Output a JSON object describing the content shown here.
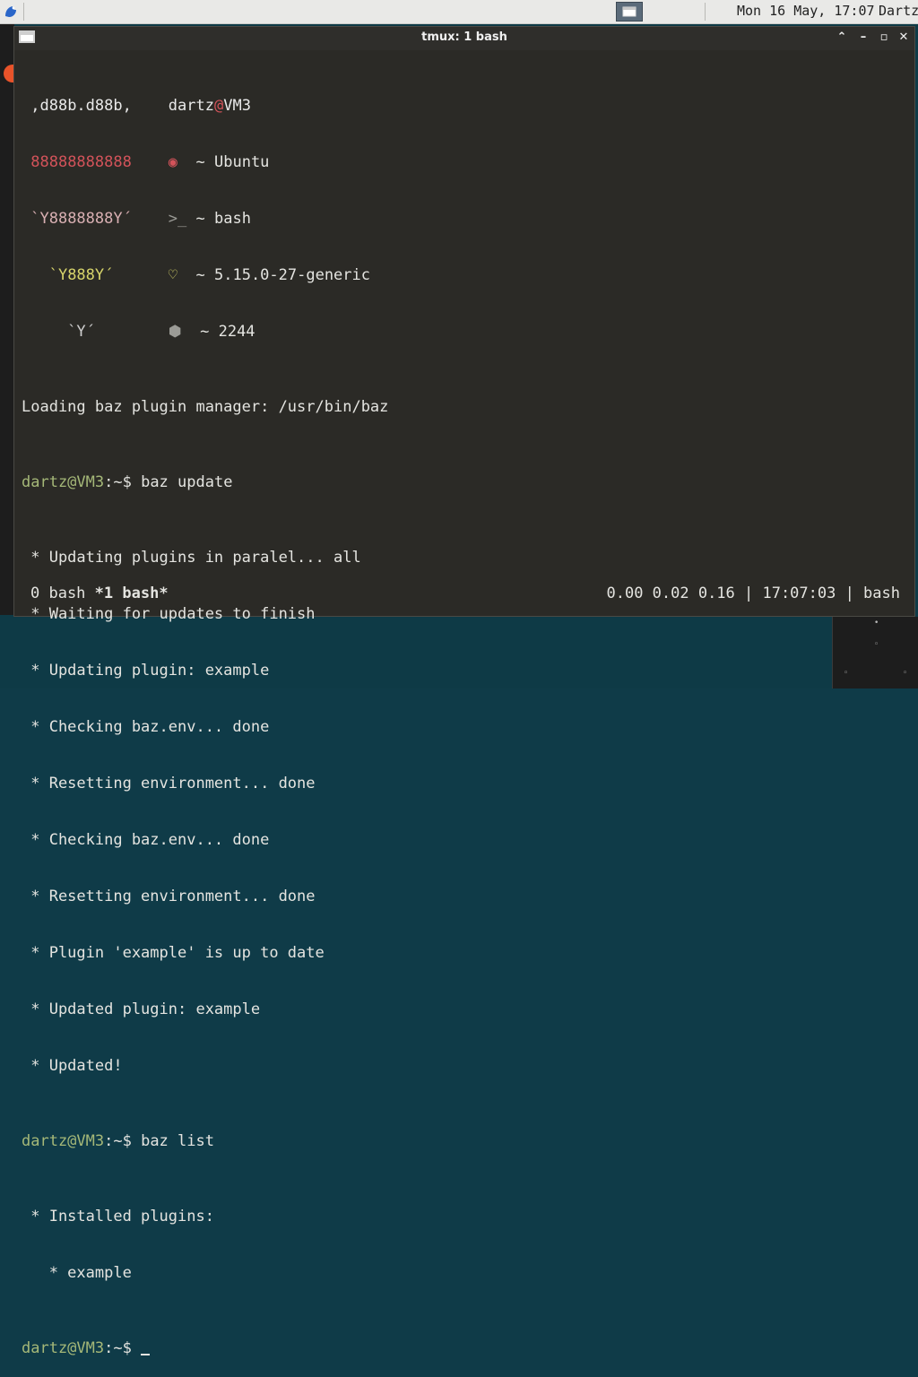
{
  "taskbar": {
    "clock": "Mon 16 May, 17:07",
    "user": "Dartz"
  },
  "window": {
    "title": "tmux: 1 bash",
    "controls": {
      "up": "⌃",
      "minimize": "–",
      "maximize": "▫",
      "close": "✕"
    }
  },
  "neofetch": {
    "logo": [
      ",d88b.d88b,",
      "88888888888",
      "`Y8888888Y´",
      "`Y888Y´",
      "`Y´"
    ],
    "user": "dartz",
    "at": "@",
    "host": "VM3",
    "rows": [
      {
        "icon": "ubuntu-icon",
        "text": "~ Ubuntu"
      },
      {
        "icon": "shell-icon",
        "text": "~ bash"
      },
      {
        "icon": "heart-icon",
        "text": "~ 5.15.0-27-generic"
      },
      {
        "icon": "package-icon",
        "text": "~ 2244"
      }
    ],
    "icon_glyphs": {
      "ubuntu": "◉",
      "shell": ">_",
      "heart": "♡",
      "package": "⬢"
    }
  },
  "terminal": {
    "loading": "Loading baz plugin manager: /usr/bin/baz",
    "prompt_user_host": "dartz@VM3",
    "prompt_suffix": ":~$ ",
    "cmd1": "baz update",
    "update_output": [
      " * Updating plugins in paralel... all",
      " * Waiting for updates to finish",
      " * Updating plugin: example",
      " * Checking baz.env... done",
      " * Resetting environment... done",
      " * Checking baz.env... done",
      " * Resetting environment... done",
      " * Plugin 'example' is up to date",
      " * Updated plugin: example",
      " * Updated!"
    ],
    "cmd2": "baz list",
    "list_output": [
      " * Installed plugins:",
      "   * example"
    ]
  },
  "status_bar": {
    "win0": "0 bash",
    "win1": "*1 bash*",
    "right": "0.00 0.02 0.16 | 17:07:03 | bash"
  },
  "colors": {
    "terminal_bg": "#2b2a26",
    "prompt_green": "#a5b878",
    "desktop_bg": "#0e3a46"
  }
}
